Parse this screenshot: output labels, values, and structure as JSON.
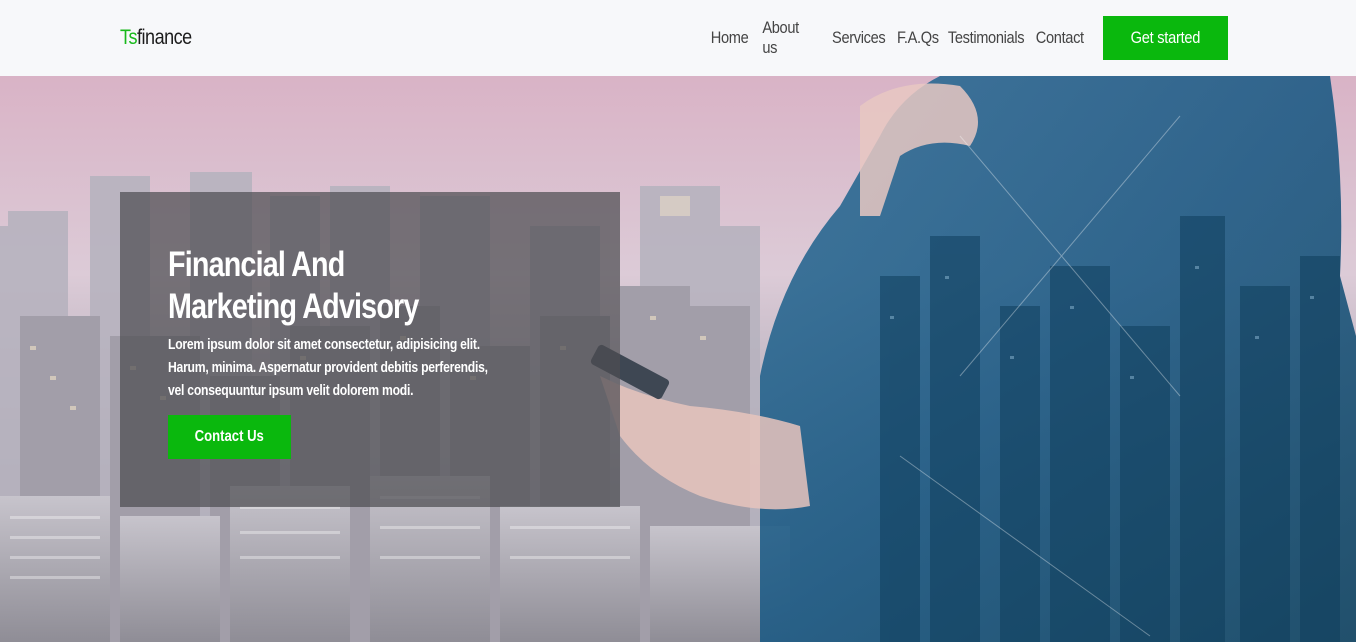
{
  "brand": {
    "accent": "Ts",
    "rest": "finance"
  },
  "nav": {
    "links": [
      "Home",
      "About us",
      "Services",
      "F.A.Qs",
      "Testimonials",
      "Contact"
    ],
    "cta": "Get started"
  },
  "hero": {
    "title_line1": "Financial And",
    "title_line2": "Marketing Advisory",
    "text": "Lorem ipsum dolor sit amet consectetur, adipisicing elit. Harum, minima. Aspernatur provident debitis perferendis, vel consequuntur ipsum velit dolorem modi.",
    "button": "Contact Us"
  },
  "colors": {
    "accent": "#0ab80d",
    "navbar_bg": "#f7f8fa",
    "panel": "rgba(78,78,82,0.72)"
  }
}
